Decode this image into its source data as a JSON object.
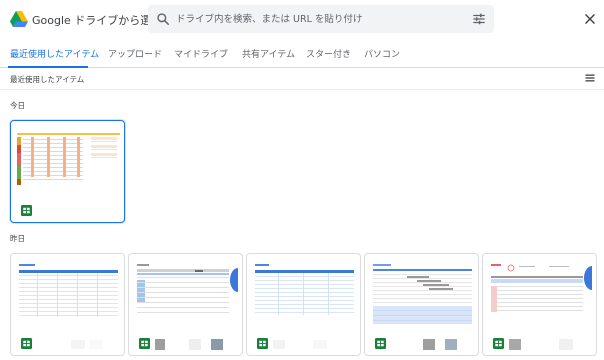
{
  "header": {
    "app_title": "Google ドライブから選択",
    "search_placeholder": "ドライブ内を検索、または URL を貼り付け"
  },
  "tabs": [
    {
      "label": "最近使用したアイテム",
      "active": true
    },
    {
      "label": "アップロード",
      "active": false
    },
    {
      "label": "マイドライブ",
      "active": false
    },
    {
      "label": "共有アイテム",
      "active": false
    },
    {
      "label": "スター付き",
      "active": false
    },
    {
      "label": "パソコン",
      "active": false
    }
  ],
  "subheader": {
    "title": "最近使用したアイテム"
  },
  "sections": {
    "today": "今日",
    "yesterday": "昨日"
  },
  "colors": {
    "accent": "#1a73e8",
    "sheets_green": "#188038",
    "muted_text": "#5f6368",
    "border": "#dadce0"
  },
  "icons": {
    "logo": "google-drive-logo",
    "search": "search-icon",
    "tune": "tune-icon",
    "close": "close-icon",
    "list_view": "list-view-icon",
    "file_type": "google-sheets-icon"
  },
  "files": {
    "today": [
      {
        "type": "spreadsheet",
        "selected": true
      }
    ],
    "yesterday": [
      {
        "type": "spreadsheet"
      },
      {
        "type": "spreadsheet"
      },
      {
        "type": "spreadsheet"
      },
      {
        "type": "spreadsheet"
      },
      {
        "type": "spreadsheet"
      }
    ]
  }
}
